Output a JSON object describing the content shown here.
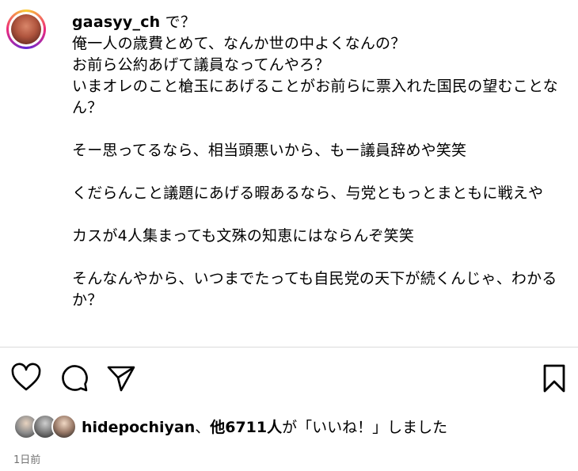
{
  "post": {
    "username": "gaasyy_ch",
    "caption_body": " で？\n俺一人の歳費とめて、なんか世の中よくなんの？\nお前ら公約あげて議員なってんやろ？\nいまオレのこと槍玉にあげることがお前らに票入れた国民の望むことなん？\n\nそー思ってるなら、相当頭悪いから、もー議員辞めや笑笑\n\nくだらんこと議題にあげる暇あるなら、与党ともっとまともに戦えや\n\nカスが4人集まっても文殊の知恵にはならんぞ笑笑\n\nそんなんやから、いつまでたっても自民党の天下が続くんじゃ、わかるか？"
  },
  "actions": {
    "like_icon": "heart-icon",
    "comment_icon": "comment-icon",
    "share_icon": "paper-plane-icon",
    "save_icon": "bookmark-icon"
  },
  "likes": {
    "liker_name": "hidepochiyan",
    "separator": "、",
    "others_count": "他6711人",
    "suffix": "が「いいね！」しました"
  },
  "timestamp": "1日前"
}
